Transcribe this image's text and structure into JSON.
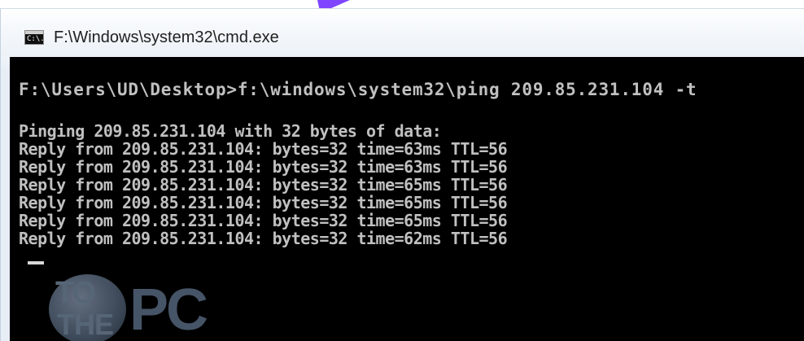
{
  "window": {
    "title": "F:\\Windows\\system32\\cmd.exe",
    "icon": "cmd-icon",
    "icon_text": "C:\\."
  },
  "console": {
    "prompt_command": "F:\\Users\\UD\\Desktop>f:\\windows\\system32\\ping 209.85.231.104 -t",
    "output": [
      "Pinging 209.85.231.104 with 32 bytes of data:",
      "Reply from 209.85.231.104: bytes=32 time=63ms TTL=56",
      "Reply from 209.85.231.104: bytes=32 time=63ms TTL=56",
      "Reply from 209.85.231.104: bytes=32 time=65ms TTL=56",
      "Reply from 209.85.231.104: bytes=32 time=65ms TTL=56",
      "Reply from 209.85.231.104: bytes=32 time=65ms TTL=56",
      "Reply from 209.85.231.104: bytes=32 time=62ms TTL=56"
    ],
    "cursor": "_"
  },
  "watermark": {
    "line_1": "TO",
    "line_2": "THE",
    "line_3": "PC"
  },
  "colors": {
    "console_background": "#000000",
    "console_text": "#c0c0c0",
    "pointer": "#8a4bff"
  }
}
